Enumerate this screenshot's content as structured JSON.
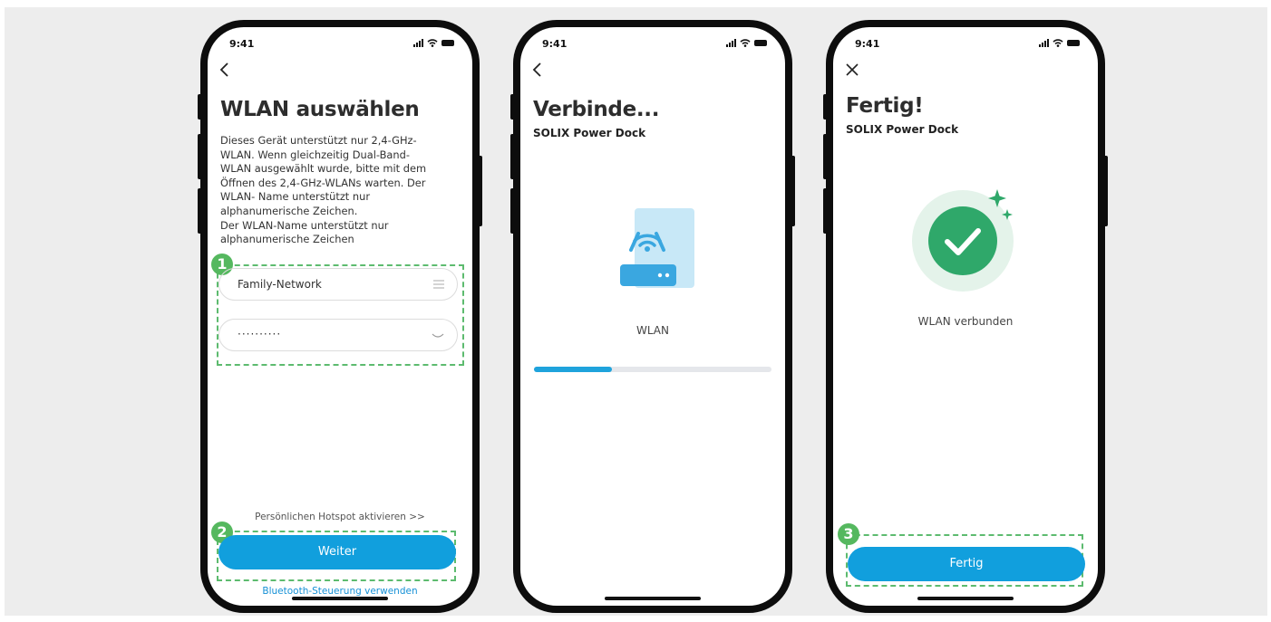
{
  "status": {
    "time": "9:41"
  },
  "screen1": {
    "title": "WLAN auswählen",
    "description": "Dieses Gerät unterstützt nur 2,4-GHz-\nWLAN. Wenn gleichzeitig Dual-Band-\nWLAN ausgewählt wurde, bitte mit dem\nÖffnen des 2,4-GHz-WLANs warten. Der\nWLAN- Name unterstützt nur\nalphanumerische Zeichen.\nDer WLAN-Name unterstützt nur\nalphanumerische Zeichen",
    "network_value": "Family-Network",
    "password_value": "··········",
    "hotspot_link": "Persönlichen Hotspot aktivieren >>",
    "next_label": "Weiter",
    "bluetooth_link": "Bluetooth-Steuerung verwenden",
    "marker1": "1",
    "marker2": "2"
  },
  "screen2": {
    "title": "Verbinde...",
    "subtitle": "SOLIX Power Dock",
    "wlan_label": "WLAN",
    "progress": 0.33,
    "colors": {
      "progress_fill": "#1fa3dc",
      "progress_track": "#e5e7eb"
    }
  },
  "screen3": {
    "title": "Fertig!",
    "subtitle": "SOLIX Power Dock",
    "status": "WLAN verbunden",
    "done_label": "Fertig",
    "marker3": "3"
  },
  "colors": {
    "accent": "#119fdd",
    "marker": "#55b85f",
    "success": "#2fa86a"
  },
  "icons": [
    "back-icon",
    "close-icon",
    "list-icon",
    "eye-closed-icon",
    "router-wifi-icon",
    "check-icon",
    "sparkle-icon"
  ]
}
